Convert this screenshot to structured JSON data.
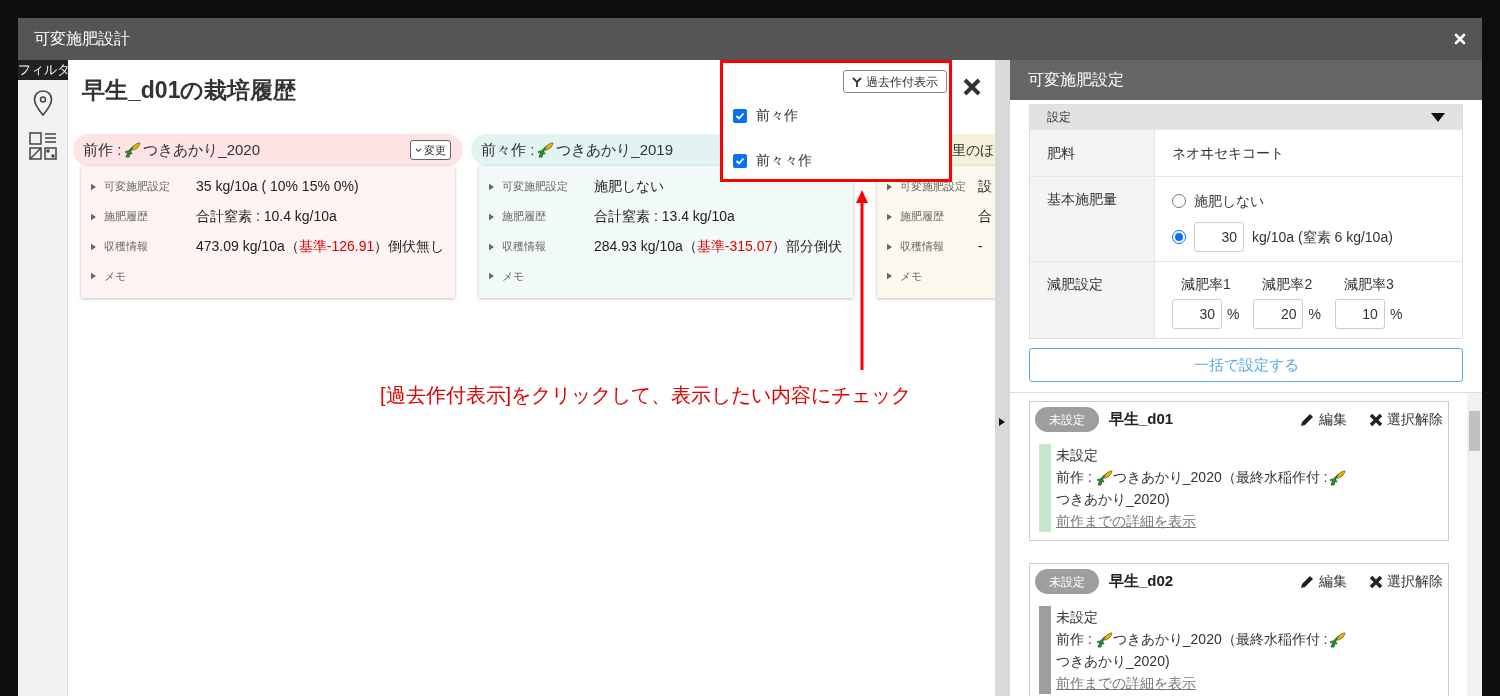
{
  "window": {
    "title": "可変施肥設計"
  },
  "side": {
    "filter_label": "フィルタ"
  },
  "history": {
    "title": "早生_d01の栽培履歴",
    "cards": [
      {
        "kind": "full",
        "label": "前作 :",
        "crop": "つきあかり_2020",
        "change_button": "変更",
        "color": "#fde3e3",
        "rows": [
          {
            "label": "可変施肥設定",
            "value": "35 kg/10a ( 10% 15% 0%)"
          },
          {
            "label": "施肥履歴",
            "value": "合計窒素 : 10.4 kg/10a"
          },
          {
            "label": "収穫情報",
            "value": "473.09 kg/10a（",
            "highlight": "基準-126.91",
            "after": "）倒伏無し"
          },
          {
            "label": "メモ"
          }
        ]
      },
      {
        "kind": "full",
        "label": "前々作 :",
        "crop": "つきあかり_2019",
        "color": "#e2f3f2",
        "rows": [
          {
            "label": "可変施肥設定",
            "value": "施肥しない"
          },
          {
            "label": "施肥履歴",
            "value": "合計窒素 : 13.4 kg/10a"
          },
          {
            "label": "収穫情報",
            "value": "284.93 kg/10a（",
            "highlight": "基準-315.07",
            "after": "）部分倒伏"
          },
          {
            "label": "メモ"
          }
        ]
      },
      {
        "kind": "partial",
        "label": "里のほ",
        "color": "#f5f1d8",
        "rows": [
          {
            "label": "可変施肥設定",
            "value": "設"
          },
          {
            "label": "施肥履歴",
            "value": "合"
          },
          {
            "label": "収穫情報",
            "value": "-"
          },
          {
            "label": "メモ"
          }
        ]
      }
    ]
  },
  "popup": {
    "button": "過去作付表示",
    "options": [
      {
        "label": "前々作",
        "checked": true
      },
      {
        "label": "前々々作",
        "checked": true
      }
    ]
  },
  "annotation": {
    "text": "[過去作付表示]をクリックして、表示したい内容にチェック"
  },
  "right": {
    "title": "可変施肥設定",
    "settings": {
      "header": "設定",
      "fertilizer_label": "肥料",
      "fertilizer": "ネオヰセキコート",
      "base_label": "基本施肥量",
      "options": [
        {
          "kind": "none",
          "label": "施肥しない",
          "selected": false
        },
        {
          "kind": "amount",
          "value": "30",
          "unit": "kg/10a (窒素 6 kg/10a)",
          "selected": true
        }
      ],
      "reduction_label": "減肥設定",
      "rates": [
        {
          "label": "減肥率1",
          "value": "30",
          "unit": "%"
        },
        {
          "label": "減肥率2",
          "value": "20",
          "unit": "%"
        },
        {
          "label": "減肥率3",
          "value": "10",
          "unit": "%"
        }
      ]
    },
    "apply_button": "一括で設定する",
    "fields": [
      {
        "status": "未設定",
        "name": "早生_d01",
        "edit": "編集",
        "deselect": "選択解除",
        "color": "#c8e6c9",
        "state": "未設定",
        "prev_label": "前作 :",
        "prev_crop": "つきあかり_2020",
        "last_label": "（最終水稲作付 :",
        "last_crop": "つきあかり_2020)",
        "link": "前作までの詳細を表示"
      },
      {
        "status": "未設定",
        "name": "早生_d02",
        "edit": "編集",
        "deselect": "選択解除",
        "color": "#9e9e9e",
        "state": "未設定",
        "prev_label": "前作 :",
        "prev_crop": "つきあかり_2020",
        "last_label": "（最終水稲作付 :",
        "last_crop": "つきあかり_2020)",
        "link": "前作までの詳細を表示"
      }
    ]
  }
}
